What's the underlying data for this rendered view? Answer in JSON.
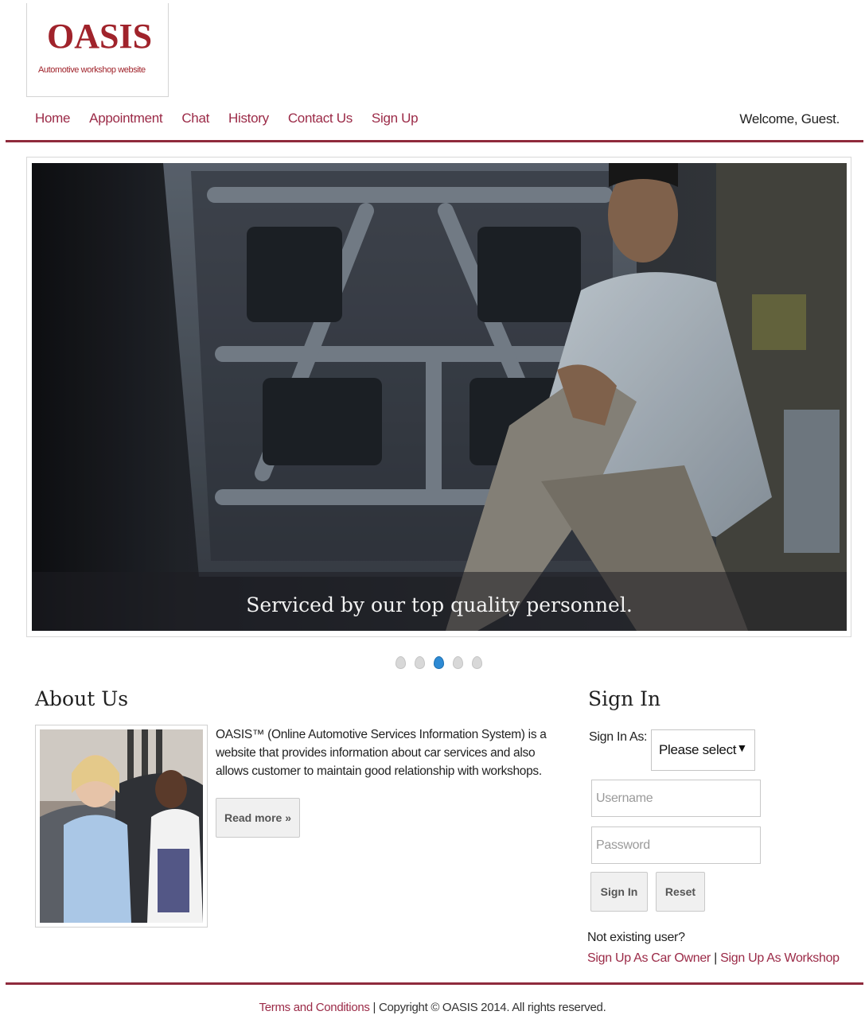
{
  "logo": {
    "title": "OASIS",
    "subtitle": "Automotive workshop website"
  },
  "nav": {
    "items": [
      "Home",
      "Appointment",
      "Chat",
      "History",
      "Contact Us",
      "Sign Up"
    ],
    "welcome": "Welcome, Guest."
  },
  "carousel": {
    "caption": "Serviced by our top quality personnel.",
    "slide_count": 5,
    "active_index": 2
  },
  "about": {
    "heading": "About Us",
    "text": "OASIS™ (Online Automotive Services Information System) is a website that provides information about car services and also allows customer to maintain good relationship with workshops.",
    "read_more": "Read more »"
  },
  "signin": {
    "heading": "Sign In",
    "role_label": "Sign In As:",
    "role_value": "Please select",
    "username_placeholder": "Username",
    "password_placeholder": "Password",
    "submit_label": "Sign In",
    "reset_label": "Reset",
    "not_user": "Not existing user?",
    "signup_owner": "Sign Up As Car Owner",
    "separator": "|",
    "signup_workshop": "Sign Up As Workshop"
  },
  "footer": {
    "terms": "Terms and Conditions",
    "copyright": "| Copyright © OASIS 2014. All rights reserved."
  },
  "colors": {
    "brand": "#a0232b",
    "link": "#9b2a47",
    "rule": "#8f2a3c",
    "active_dot": "#2d8ad4"
  }
}
